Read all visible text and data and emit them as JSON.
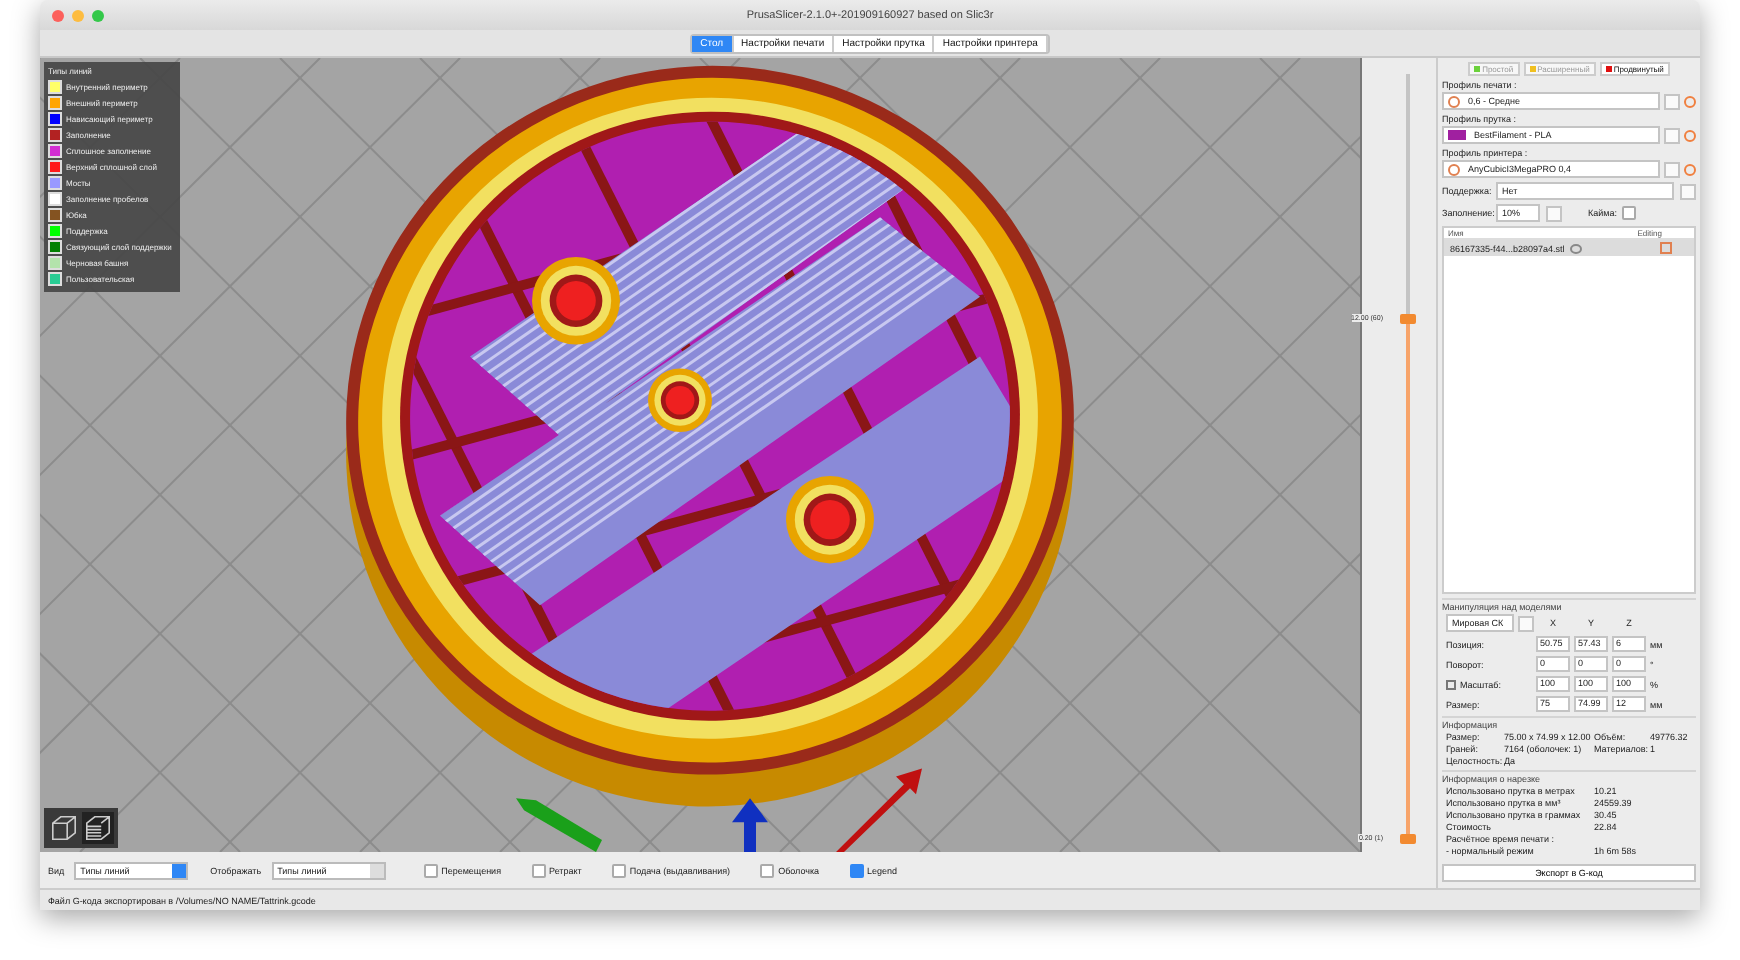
{
  "window": {
    "title": "PrusaSlicer-2.1.0+-201909160927 based on Slic3r"
  },
  "tabs": [
    {
      "label": "Стол",
      "selected": true
    },
    {
      "label": "Настройки печати",
      "selected": false
    },
    {
      "label": "Настройки прутка",
      "selected": false
    },
    {
      "label": "Настройки принтера",
      "selected": false
    }
  ],
  "legend": {
    "title": "Типы линий",
    "items": [
      {
        "label": "Внутренний периметр",
        "color": "#ffff68"
      },
      {
        "label": "Внешний периметр",
        "color": "#ffa500"
      },
      {
        "label": "Нависающий периметр",
        "color": "#0000ff"
      },
      {
        "label": "Заполнение",
        "color": "#b22222"
      },
      {
        "label": "Сплошное заполнение",
        "color": "#d22dd2"
      },
      {
        "label": "Верхний сплошной слой",
        "color": "#ff1a1a"
      },
      {
        "label": "Мосты",
        "color": "#9999ff"
      },
      {
        "label": "Заполнение пробелов",
        "color": "#ffffff"
      },
      {
        "label": "Юбка",
        "color": "#845321"
      },
      {
        "label": "Поддержка",
        "color": "#00ff00"
      },
      {
        "label": "Связующий слой поддержки",
        "color": "#008000"
      },
      {
        "label": "Черновая башня",
        "color": "#b3e3ab"
      },
      {
        "label": "Пользовательская",
        "color": "#28cc94"
      }
    ]
  },
  "layer_slider": {
    "thumbs": [
      {
        "label": "12.00 (60)",
        "level": 0.68
      },
      {
        "label": "0.20 (1)",
        "level": 0
      }
    ]
  },
  "sidebar": {
    "modes": [
      {
        "label": "Простой",
        "color": "#6bd13b",
        "selected": false
      },
      {
        "label": "Расширенный",
        "color": "#f0c020",
        "selected": false
      },
      {
        "label": "Продвинутый",
        "color": "#e01010",
        "selected": true
      }
    ],
    "profiles": [
      {
        "label": "Профиль печати :",
        "value": "0,6 - Средне"
      },
      {
        "label": "Профиль прутка :",
        "value": "BestFilament - PLA",
        "color": "#a020a0"
      },
      {
        "label": "Профиль принтера :",
        "value": "AnyCubicI3MegaPRO 0,4"
      }
    ],
    "support": {
      "label": "Поддержка:",
      "value": "Нет"
    },
    "infill": {
      "label": "Заполнение:",
      "value": "10%"
    },
    "brim": {
      "label": "Кайма:",
      "checked": false
    },
    "object_list": {
      "columns": [
        "Имя",
        "Editing"
      ],
      "rows": [
        {
          "name": "86167335-f44...b28097a4.stl",
          "selected": true
        }
      ]
    },
    "manipulation": {
      "title": "Манипуляция над моделями",
      "coordinate_system": "Мировая СК",
      "axes": [
        "X",
        "Y",
        "Z"
      ],
      "rows": [
        {
          "label": "Позиция:",
          "values": [
            "50.75",
            "57.43",
            "6"
          ],
          "unit": "мм",
          "lock": false
        },
        {
          "label": "Поворот:",
          "values": [
            "0",
            "0",
            "0"
          ],
          "unit": "°",
          "lock": false
        },
        {
          "label": "Масштаб:",
          "values": [
            "100",
            "100",
            "100"
          ],
          "unit": "%",
          "lock": true
        },
        {
          "label": "Размер:",
          "values": [
            "75",
            "74.99",
            "12"
          ],
          "unit": "мм",
          "lock": false
        }
      ]
    },
    "info": {
      "title": "Информация",
      "rows": [
        [
          {
            "label": "Размер:",
            "value": "75.00 x 74.99 x 12.00"
          },
          {
            "label": "Объём:",
            "value": "49776.32"
          }
        ],
        [
          {
            "label": "Граней:",
            "value": "7164 (оболочек: 1)"
          },
          {
            "label": "Материалов:",
            "value": "1"
          }
        ],
        [
          {
            "label": "Целостность:",
            "value": "Да"
          }
        ]
      ]
    },
    "slice_info": {
      "title": "Информация о нарезке",
      "items": [
        {
          "label": "Использовано прутка в метрах",
          "value": "10.21"
        },
        {
          "label": "Использовано прутка в мм³",
          "value": "24559.39"
        },
        {
          "label": "Использовано прутка в граммах",
          "value": "30.45"
        },
        {
          "label": "Стоимость",
          "value": "22.84"
        },
        {
          "label": "Расчётное время печати :"
        },
        {
          "label": "- нормальный режим",
          "value": "1h 6m 58s"
        }
      ]
    },
    "export_button": "Экспорт в G-код"
  },
  "bottom_bar": {
    "view_label": "Вид",
    "view_value": "Типы линий",
    "show_label": "Отображать",
    "show_value": "Типы линий",
    "options": [
      {
        "label": "Перемещения",
        "checked": false
      },
      {
        "label": "Ретракт",
        "checked": false
      },
      {
        "label": "Подача (выдавливания)",
        "checked": false
      },
      {
        "label": "Оболочка",
        "checked": false
      },
      {
        "label": "Legend",
        "checked": true
      }
    ]
  },
  "status_bar": "Файл G-кода экспортирован в /Volumes/NO NAME/Tattrink.gcode"
}
